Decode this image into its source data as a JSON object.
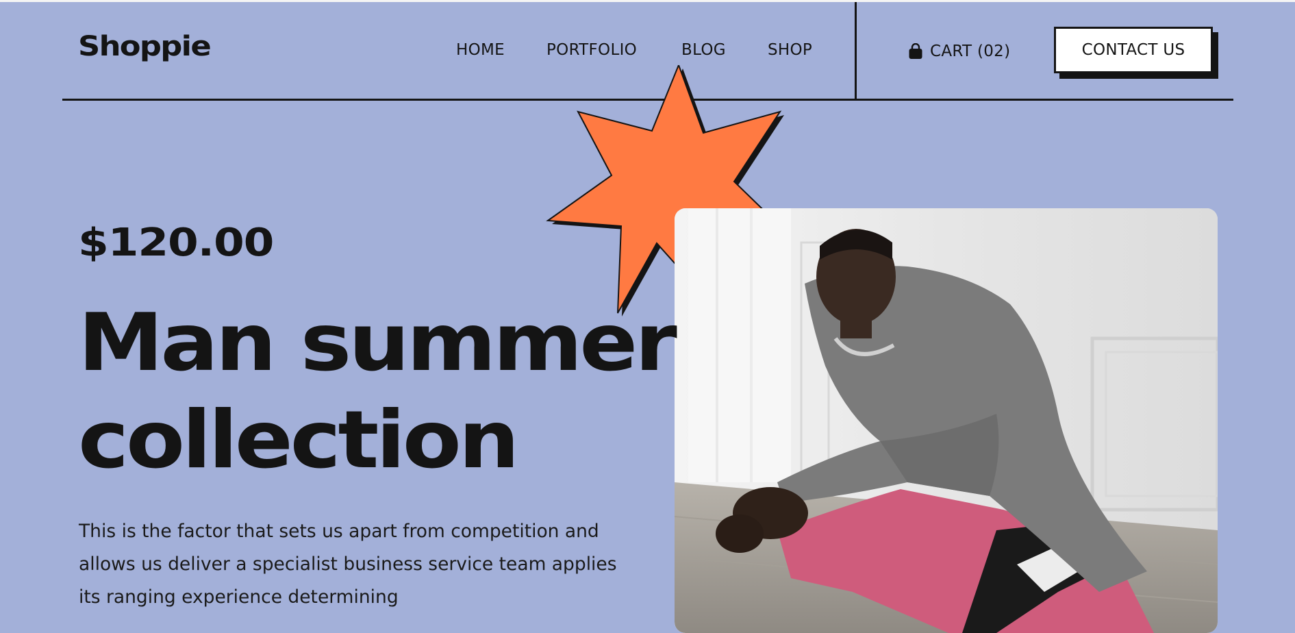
{
  "header": {
    "logo": "Shoppie",
    "nav": [
      "HOME",
      "PORTFOLIO",
      "BLOG",
      "SHOP"
    ],
    "cart_label": "CART (02)",
    "cart_icon": "shopping-bag-icon",
    "contact_label": "CONTACT US"
  },
  "hero": {
    "price": "$120.00",
    "title_line1": "Man summer",
    "title_line2": "collection",
    "description": "This is the factor that sets us apart from competition and allows us deliver a specialist business service team applies its ranging experience determining",
    "decor_icon": "burst-star-icon",
    "image_alt": "Model in grey sweatshirt and pink track pants crouching"
  },
  "colors": {
    "background": "#a3b0d9",
    "ink": "#141414",
    "accent": "#ff7a42",
    "button_bg": "#ffffff"
  }
}
